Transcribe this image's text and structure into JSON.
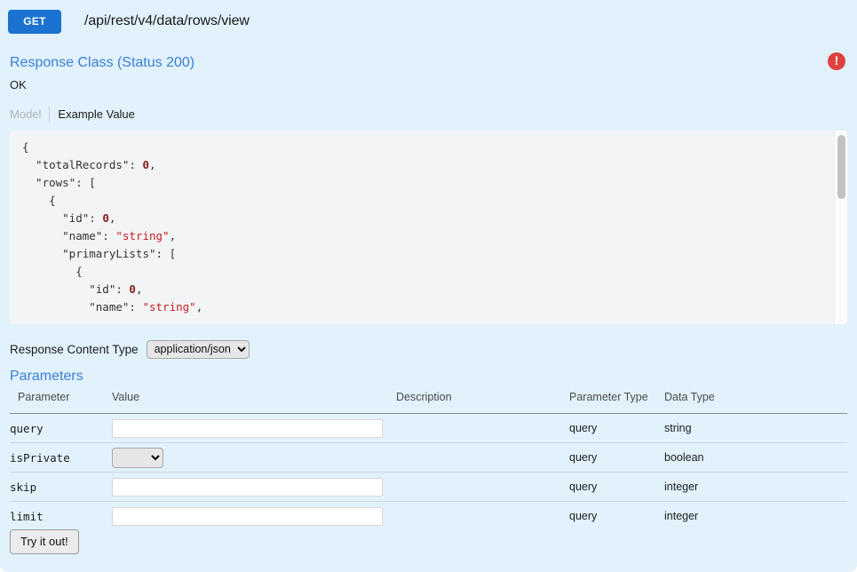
{
  "operation": {
    "method": "GET",
    "path": "/api/rest/v4/data/rows/view",
    "method_color": "#1b72d0"
  },
  "warning": {
    "icon": "exclamation-circle-icon",
    "color": "#e04141",
    "glyph": "!"
  },
  "response_class": {
    "title": "Response Class (Status 200)",
    "description": "OK",
    "tabs": [
      {
        "label": "Model",
        "active": false
      },
      {
        "label": "Example Value",
        "active": true
      }
    ],
    "example_value": "{\n  \"totalRecords\": 0,\n  \"rows\": [\n    {\n      \"id\": 0,\n      \"name\": \"string\",\n      \"primaryLists\": [\n        {\n          \"id\": 0,\n          \"name\": \"string\","
  },
  "content_type": {
    "label": "Response Content Type",
    "selected": "application/json",
    "options": [
      "application/json"
    ]
  },
  "parameters": {
    "title": "Parameters",
    "columns": [
      "Parameter",
      "Value",
      "Description",
      "Parameter Type",
      "Data Type"
    ],
    "rows": [
      {
        "name": "query",
        "value": "",
        "placeholder": "",
        "control": "text",
        "description": "",
        "parameter_type": "query",
        "data_type": "string"
      },
      {
        "name": "isPrivate",
        "value": "",
        "placeholder": "",
        "control": "select",
        "options": [
          "",
          "true",
          "false"
        ],
        "description": "",
        "parameter_type": "query",
        "data_type": "boolean"
      },
      {
        "name": "skip",
        "value": "",
        "placeholder": "",
        "control": "text",
        "description": "",
        "parameter_type": "query",
        "data_type": "integer"
      },
      {
        "name": "limit",
        "value": "",
        "placeholder": "",
        "control": "text",
        "description": "",
        "parameter_type": "query",
        "data_type": "integer"
      }
    ]
  },
  "actions": {
    "try_it_out": "Try it out!"
  }
}
